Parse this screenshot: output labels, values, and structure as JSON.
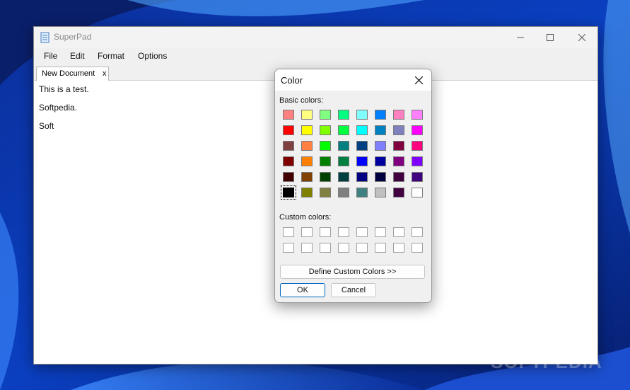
{
  "window": {
    "title": "SuperPad",
    "menus": [
      "File",
      "Edit",
      "Format",
      "Options"
    ],
    "tab": {
      "label": "New Document",
      "close": "x"
    },
    "editor_lines": [
      "This is a test.",
      "Softpedia.",
      "Soft"
    ]
  },
  "dialog": {
    "title": "Color",
    "basic_label": "Basic colors:",
    "custom_label": "Custom colors:",
    "basic_colors": [
      [
        "#ff8080",
        "#ffff80",
        "#80ff80",
        "#00ff80",
        "#80ffff",
        "#0080ff",
        "#ff80c0",
        "#ff80ff"
      ],
      [
        "#ff0000",
        "#ffff00",
        "#80ff00",
        "#00ff40",
        "#00ffff",
        "#0080c0",
        "#8080c0",
        "#ff00ff"
      ],
      [
        "#804040",
        "#ff8040",
        "#00ff00",
        "#008080",
        "#004080",
        "#8080ff",
        "#800040",
        "#ff0080"
      ],
      [
        "#800000",
        "#ff8000",
        "#008000",
        "#008040",
        "#0000ff",
        "#0000a0",
        "#800080",
        "#8000ff"
      ],
      [
        "#400000",
        "#804000",
        "#004000",
        "#004040",
        "#000080",
        "#000040",
        "#400040",
        "#400080"
      ],
      [
        "#000000",
        "#808000",
        "#808040",
        "#808080",
        "#408080",
        "#c0c0c0",
        "#400040",
        "#ffffff"
      ]
    ],
    "selected_color": "#000000",
    "buttons": {
      "define": "Define Custom Colors >>",
      "ok": "OK",
      "cancel": "Cancel"
    }
  },
  "watermark": "SOFTPEDIA"
}
